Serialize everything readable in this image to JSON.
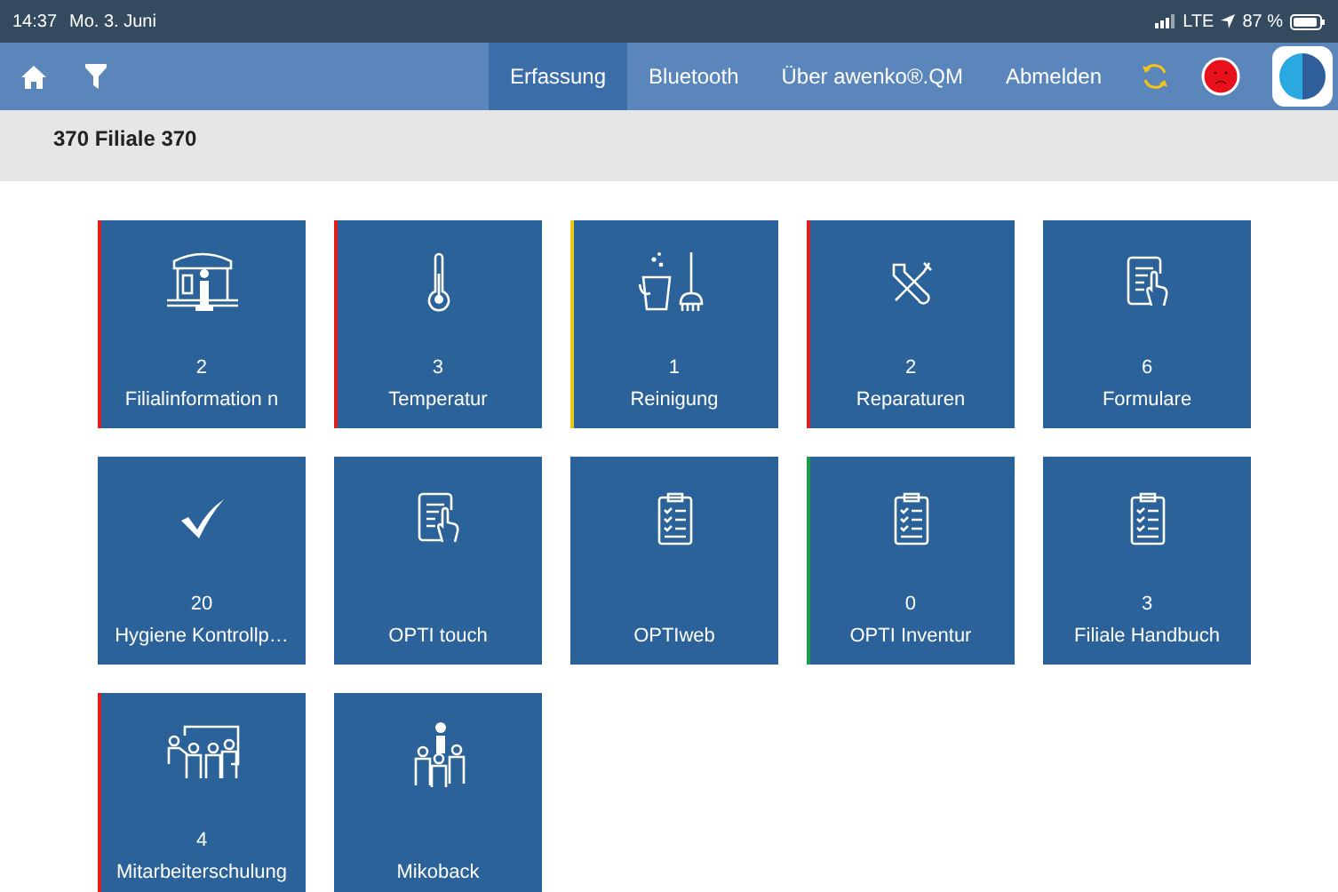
{
  "status_bar": {
    "time": "14:37",
    "date": "Mo. 3. Juni",
    "network": "LTE",
    "battery": "87 %"
  },
  "nav": {
    "tabs": [
      {
        "label": "Erfassung",
        "selected": true
      },
      {
        "label": "Bluetooth",
        "selected": false
      },
      {
        "label": "Über awenko®.QM",
        "selected": false
      },
      {
        "label": "Abmelden",
        "selected": false
      }
    ]
  },
  "header": {
    "title": "370 Filiale 370"
  },
  "tiles": [
    {
      "kind": "store",
      "count": "2",
      "label": "Filialinformation n",
      "color": "#e0201f"
    },
    {
      "kind": "thermometer",
      "count": "3",
      "label": "Temperatur",
      "color": "#e0201f"
    },
    {
      "kind": "cleaning",
      "count": "1",
      "label": "Reinigung",
      "color": "#f0c419"
    },
    {
      "kind": "tools",
      "count": "2",
      "label": "Reparaturen",
      "color": "#e0201f"
    },
    {
      "kind": "touch",
      "count": "6",
      "label": "Formulare"
    },
    {
      "kind": "check",
      "count": "20",
      "label": "Hygiene Kontrollp…"
    },
    {
      "kind": "touch",
      "label": "OPTI touch"
    },
    {
      "kind": "clipboard",
      "label": "OPTIweb"
    },
    {
      "kind": "clipboard",
      "count": "0",
      "label": "OPTI Inventur",
      "color": "#1f9e4a"
    },
    {
      "kind": "clipboard",
      "count": "3",
      "label": "Filiale Handbuch"
    },
    {
      "kind": "training",
      "count": "4",
      "label": "Mitarbeiterschulung",
      "color": "#e0201f"
    },
    {
      "kind": "people",
      "label": "Mikoback"
    }
  ]
}
